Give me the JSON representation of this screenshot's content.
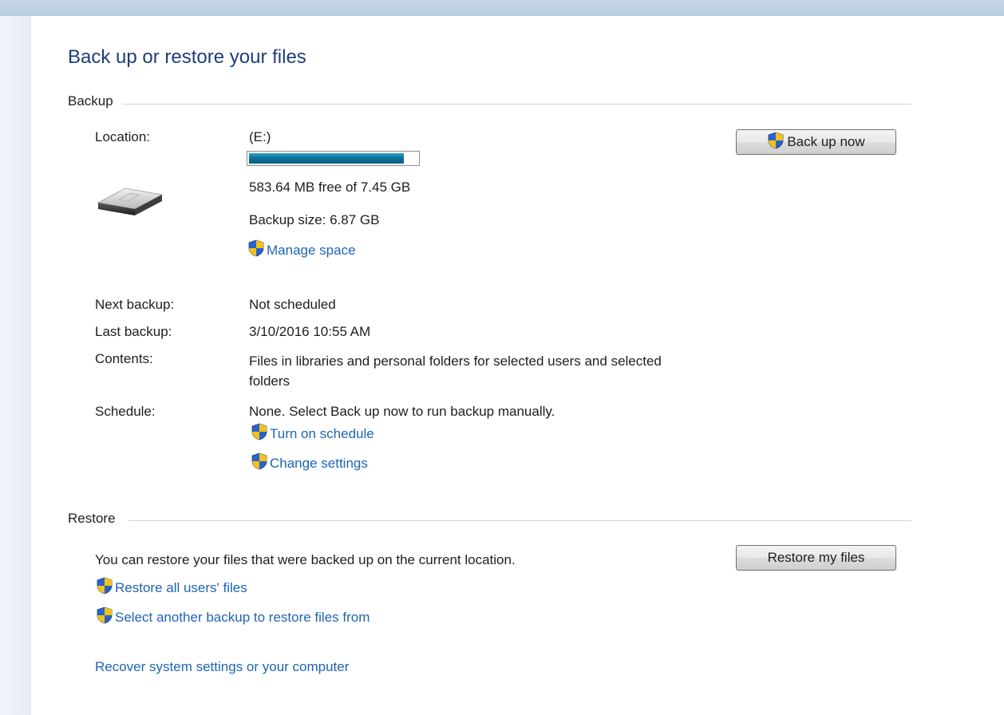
{
  "page": {
    "title": "Back up or restore your files"
  },
  "backup": {
    "section_label": "Backup",
    "location_label": "Location:",
    "location_value": "(E:)",
    "used_fraction": 0.9217,
    "free_space_text": "583.64 MB free of 7.45 GB",
    "backup_size_text": "Backup size: 6.87 GB",
    "manage_space_link": "Manage space",
    "back_up_now_button": "Back up now",
    "next_backup_label": "Next backup:",
    "next_backup_value": "Not scheduled",
    "last_backup_label": "Last backup:",
    "last_backup_value": "3/10/2016 10:55 AM",
    "contents_label": "Contents:",
    "contents_value": "Files in libraries and personal folders for selected users and selected folders",
    "schedule_label": "Schedule:",
    "schedule_value": "None. Select Back up now to run backup manually.",
    "turn_on_schedule_link": "Turn on schedule",
    "change_settings_link": "Change settings"
  },
  "restore": {
    "section_label": "Restore",
    "description": "You can restore your files that were backed up on the current location.",
    "restore_my_files_button": "Restore my files",
    "restore_all_users_link": "Restore all users' files",
    "select_another_backup_link": "Select another backup to restore files from",
    "recover_system_link": "Recover system settings or your computer"
  },
  "icons": {
    "uac_shield": "uac-shield-icon",
    "drive": "removable-drive-icon"
  },
  "colors": {
    "title": "#1f3d7a",
    "link": "#1e64b4",
    "progress": "#0b6f99"
  }
}
